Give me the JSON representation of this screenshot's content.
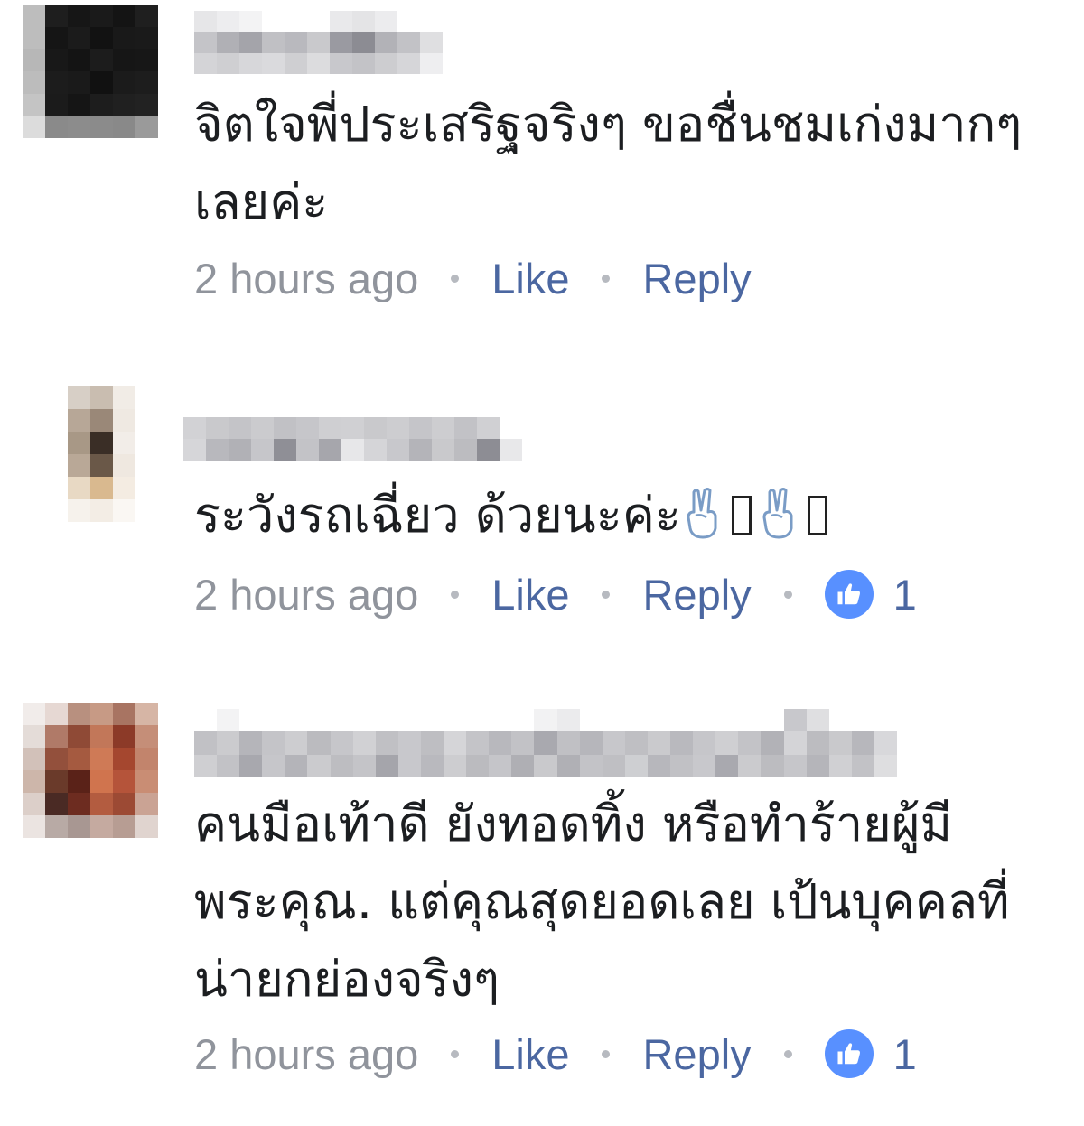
{
  "comments": [
    {
      "text": "จิตใจพี่ประเสริฐจริงๆ ขอชื่นชมเก่งมากๆ เลยค่ะ",
      "time": "2 hours ago",
      "like_label": "Like",
      "reply_label": "Reply"
    },
    {
      "text": "ระวังรถเฉี่ยว ด้วยนะค่ะ",
      "time": "2 hours ago",
      "like_label": "Like",
      "reply_label": "Reply",
      "reaction_count": "1"
    },
    {
      "text": "คนมือเท้าดี ยังทอดทิ้ง หรือทำร้ายผู้มีพระคุณ. แต่คุณสุดยอดเลย เป้นบุคคลที่น่ายกย่องจริงๆ",
      "time": "2 hours ago",
      "like_label": "Like",
      "reply_label": "Reply",
      "reaction_count": "1"
    }
  ],
  "colors": {
    "link": "#4b67a1",
    "meta_gray": "#90949c",
    "like_badge": "#5890ff"
  }
}
